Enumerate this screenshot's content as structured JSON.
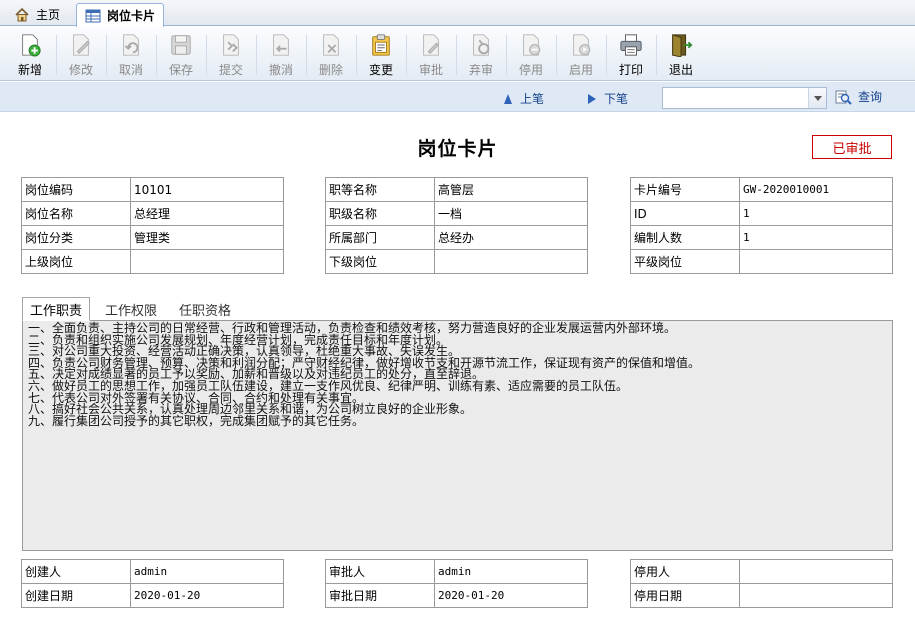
{
  "tabs": {
    "home_label": "主页",
    "active_label": "岗位卡片"
  },
  "toolbar": [
    {
      "name": "new",
      "label": "新增",
      "icon": "new-icon",
      "enabled": true
    },
    {
      "name": "edit",
      "label": "修改",
      "icon": "edit-icon",
      "enabled": false
    },
    {
      "name": "cancel",
      "label": "取消",
      "icon": "cancel-icon",
      "enabled": false
    },
    {
      "name": "save",
      "label": "保存",
      "icon": "save-icon",
      "enabled": false
    },
    {
      "name": "submit",
      "label": "提交",
      "icon": "submit-icon",
      "enabled": false
    },
    {
      "name": "withdraw",
      "label": "撤消",
      "icon": "withdraw-icon",
      "enabled": false
    },
    {
      "name": "delete",
      "label": "删除",
      "icon": "delete-icon",
      "enabled": false
    },
    {
      "name": "change",
      "label": "变更",
      "icon": "change-icon",
      "enabled": true
    },
    {
      "name": "approve",
      "label": "审批",
      "icon": "approve-icon",
      "enabled": false
    },
    {
      "name": "unapprove",
      "label": "弃审",
      "icon": "unapprove-icon",
      "enabled": false
    },
    {
      "name": "disable",
      "label": "停用",
      "icon": "disable-icon",
      "enabled": false
    },
    {
      "name": "enable",
      "label": "启用",
      "icon": "enable-icon",
      "enabled": false
    },
    {
      "name": "print",
      "label": "打印",
      "icon": "print-icon",
      "enabled": true
    },
    {
      "name": "exit",
      "label": "退出",
      "icon": "exit-icon",
      "enabled": true
    }
  ],
  "nav": {
    "prev_label": "上笔",
    "next_label": "下笔",
    "search_value": "",
    "query_label": "查询"
  },
  "card": {
    "title": "岗位卡片",
    "status": "已审批",
    "status_color": "#cc0000"
  },
  "info_left": [
    {
      "label": "岗位编码",
      "value": "10101"
    },
    {
      "label": "岗位名称",
      "value": "总经理"
    },
    {
      "label": "岗位分类",
      "value": "管理类"
    },
    {
      "label": "上级岗位",
      "value": ""
    }
  ],
  "info_mid": [
    {
      "label": "职等名称",
      "value": "高管层"
    },
    {
      "label": "职级名称",
      "value": "一档"
    },
    {
      "label": "所属部门",
      "value": "总经办"
    },
    {
      "label": "下级岗位",
      "value": ""
    }
  ],
  "info_right": [
    {
      "label": "卡片编号",
      "value": "GW-2020010001"
    },
    {
      "label": "ID",
      "value": "1"
    },
    {
      "label": "编制人数",
      "value": "1"
    },
    {
      "label": "平级岗位",
      "value": ""
    }
  ],
  "subtabs": [
    "工作职责",
    "工作权限",
    "任职资格"
  ],
  "duties": [
    "一、全面负责、主持公司的日常经营、行政和管理活动，负责检查和绩效考核，努力营造良好的企业发展运营内外部环境。",
    "二、负责和组织实施公司发展规划、年度经营计划，完成责任目标和年度计划。",
    "三、对公司重大投资、经营活动正确决策，认真领导，杜绝重大事故、失误发生。",
    "四、负责公司财务管理、预算、决策和利润分配；严守财经纪律，做好增收节支和开源节流工作，保证现有资产的保值和增值。",
    "五、决定对成绩显著的员工予以奖励、加薪和晋级以及对违纪员工的处分，直至辞退。",
    "六、做好员工的思想工作，加强员工队伍建设，建立一支作风优良、纪律严明、训练有素、适应需要的员工队伍。",
    "七、代表公司对外签署有关协议、合同、合约和处理有关事宜。",
    "八、搞好社会公共关系，认真处理周边邻里关系和谐，为公司树立良好的企业形象。",
    "九、履行集团公司授予的其它职权，完成集团赋予的其它任务。"
  ],
  "footer_left": [
    {
      "label": "创建人",
      "value": "admin"
    },
    {
      "label": "创建日期",
      "value": "2020-01-20"
    }
  ],
  "footer_mid": [
    {
      "label": "审批人",
      "value": "admin"
    },
    {
      "label": "审批日期",
      "value": "2020-01-20"
    }
  ],
  "footer_right": [
    {
      "label": "停用人",
      "value": ""
    },
    {
      "label": "停用日期",
      "value": ""
    }
  ]
}
